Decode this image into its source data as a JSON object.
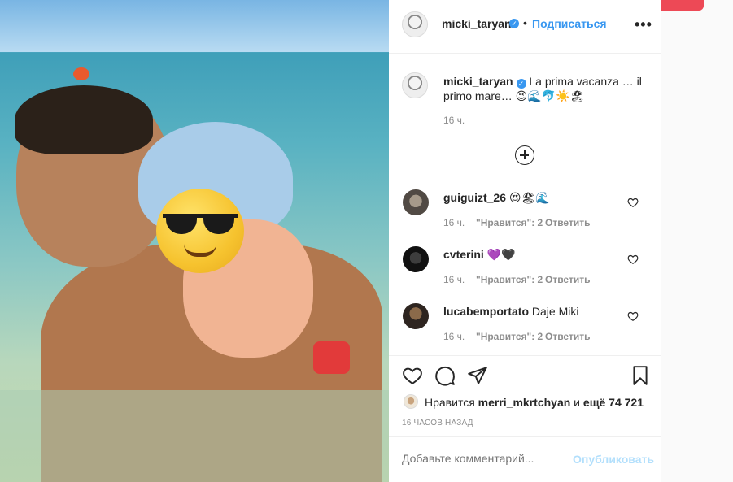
{
  "post": {
    "author": "micki_taryan",
    "follow_label": "Подписаться",
    "separator": "•",
    "more_label": "•••",
    "caption_text": "La prima vacanza … il primo mare… 😉🌊🐬☀️🏖",
    "caption_time": "16 ч.",
    "likes_prefix": "Нравится ",
    "likes_user": "merri_mkrtchyan",
    "likes_mid": " и ",
    "likes_count": "ещё 74 721",
    "timestamp": "16 ЧАСОВ НАЗАД",
    "comment_placeholder": "Добавьте комментарий...",
    "publish_label": "Опубликовать"
  },
  "comments": [
    {
      "user": "guiguizt_26",
      "text": "😍🏖🌊",
      "time": "16 ч.",
      "likes": "\"Нравится\": 2",
      "reply": "Ответить"
    },
    {
      "user": "cvterini",
      "text": "💜🖤",
      "time": "16 ч.",
      "likes": "\"Нравится\": 2",
      "reply": "Ответить"
    },
    {
      "user": "lucabemportato",
      "text": "Daje Miki",
      "time": "16 ч.",
      "likes": "\"Нравится\": 2",
      "reply": "Ответить"
    }
  ],
  "colors": {
    "accent": "#3897f0",
    "publish_disabled": "#b2dffc",
    "muted": "#8e8e8e"
  }
}
